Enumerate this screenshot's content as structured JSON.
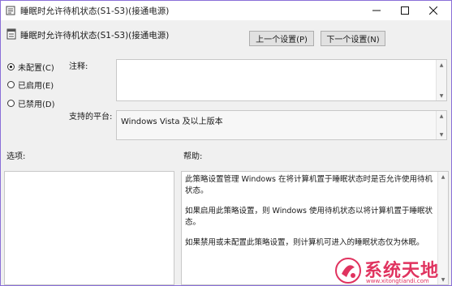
{
  "window": {
    "title": "睡眠时允许待机状态(S1-S3)(接通电源)",
    "controls": {
      "minimize": "—",
      "maximize": "☐",
      "close": "✕"
    }
  },
  "header": {
    "setting_name": "睡眠时允许待机状态(S1-S3)(接通电源)",
    "prev_button": "上一个设置(P)",
    "next_button": "下一个设置(N)"
  },
  "state": {
    "selected": "not_configured",
    "options": [
      {
        "key": "not_configured",
        "label": "未配置(C)"
      },
      {
        "key": "enabled",
        "label": "已启用(E)"
      },
      {
        "key": "disabled",
        "label": "已禁用(D)"
      }
    ]
  },
  "notes": {
    "label": "注释:",
    "value": ""
  },
  "platform": {
    "label": "支持的平台:",
    "value": "Windows Vista 及以上版本"
  },
  "options_section": {
    "label": "选项:"
  },
  "help": {
    "label": "帮助:",
    "paragraphs": [
      "此策略设置管理 Windows 在将计算机置于睡眠状态时是否允许使用待机状态。",
      "如果启用此策略设置，则 Windows 使用待机状态以将计算机置于睡眠状态。",
      "如果禁用或未配置此策略设置，则计算机可进入的睡眠状态仅为休眠。"
    ]
  },
  "watermark": {
    "brand": "系统天地",
    "url": "www.xitongtiandi.com"
  },
  "colors": {
    "window_border": "#8a6fd8",
    "watermark": "#e0335f"
  }
}
